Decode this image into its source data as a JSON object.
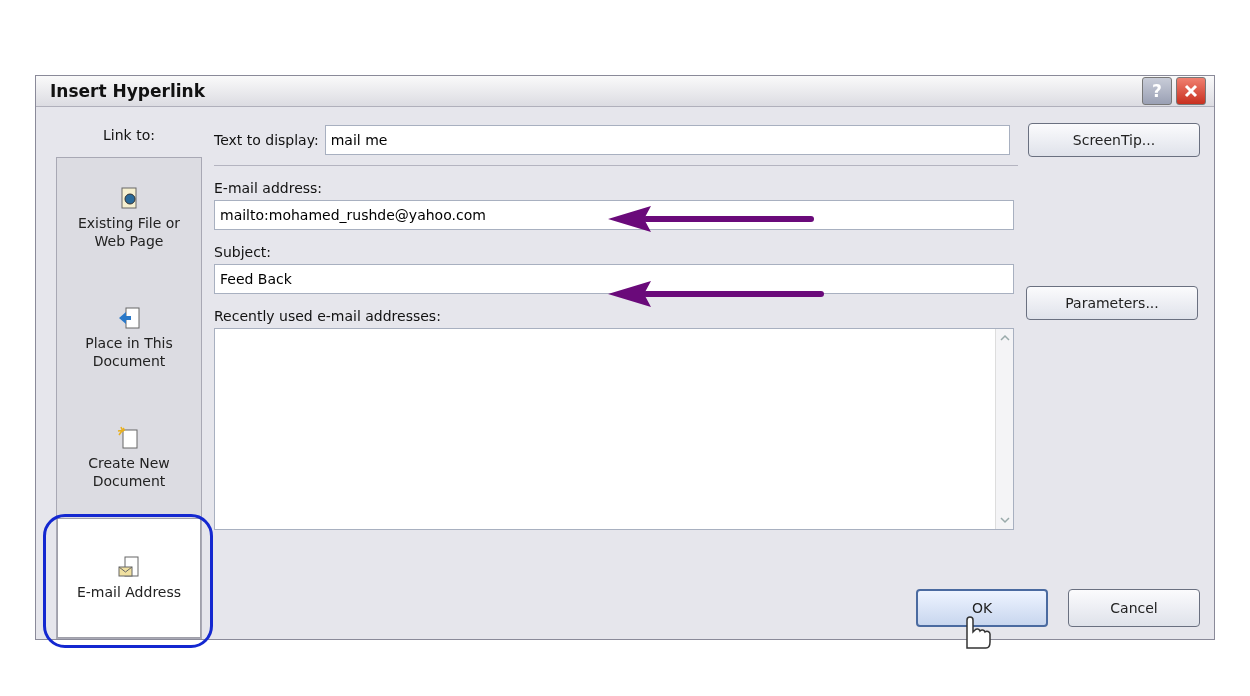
{
  "window": {
    "title": "Insert Hyperlink",
    "help_button": "?"
  },
  "sidebar": {
    "label": "Link to:",
    "items": [
      {
        "kind": "file",
        "label": "Existing File or Web Page",
        "selected": false
      },
      {
        "kind": "place",
        "label": "Place in This Document",
        "selected": false
      },
      {
        "kind": "new",
        "label": "Create New Document",
        "selected": false
      },
      {
        "kind": "email",
        "label": "E-mail Address",
        "selected": true
      }
    ]
  },
  "text_to_display": {
    "label": "Text to display:",
    "value": "mail me"
  },
  "screentip_button": "ScreenTip...",
  "email_address": {
    "label": "E-mail address:",
    "value": "mailto:mohamed_rushde@yahoo.com"
  },
  "subject": {
    "label": "Subject:",
    "value": "Feed Back"
  },
  "recent_addresses": {
    "label": "Recently used e-mail addresses:"
  },
  "parameters_button": "Parameters...",
  "buttons": [
    {
      "label": "OK",
      "selected": true
    },
    {
      "label": "Cancel",
      "selected": false
    }
  ]
}
